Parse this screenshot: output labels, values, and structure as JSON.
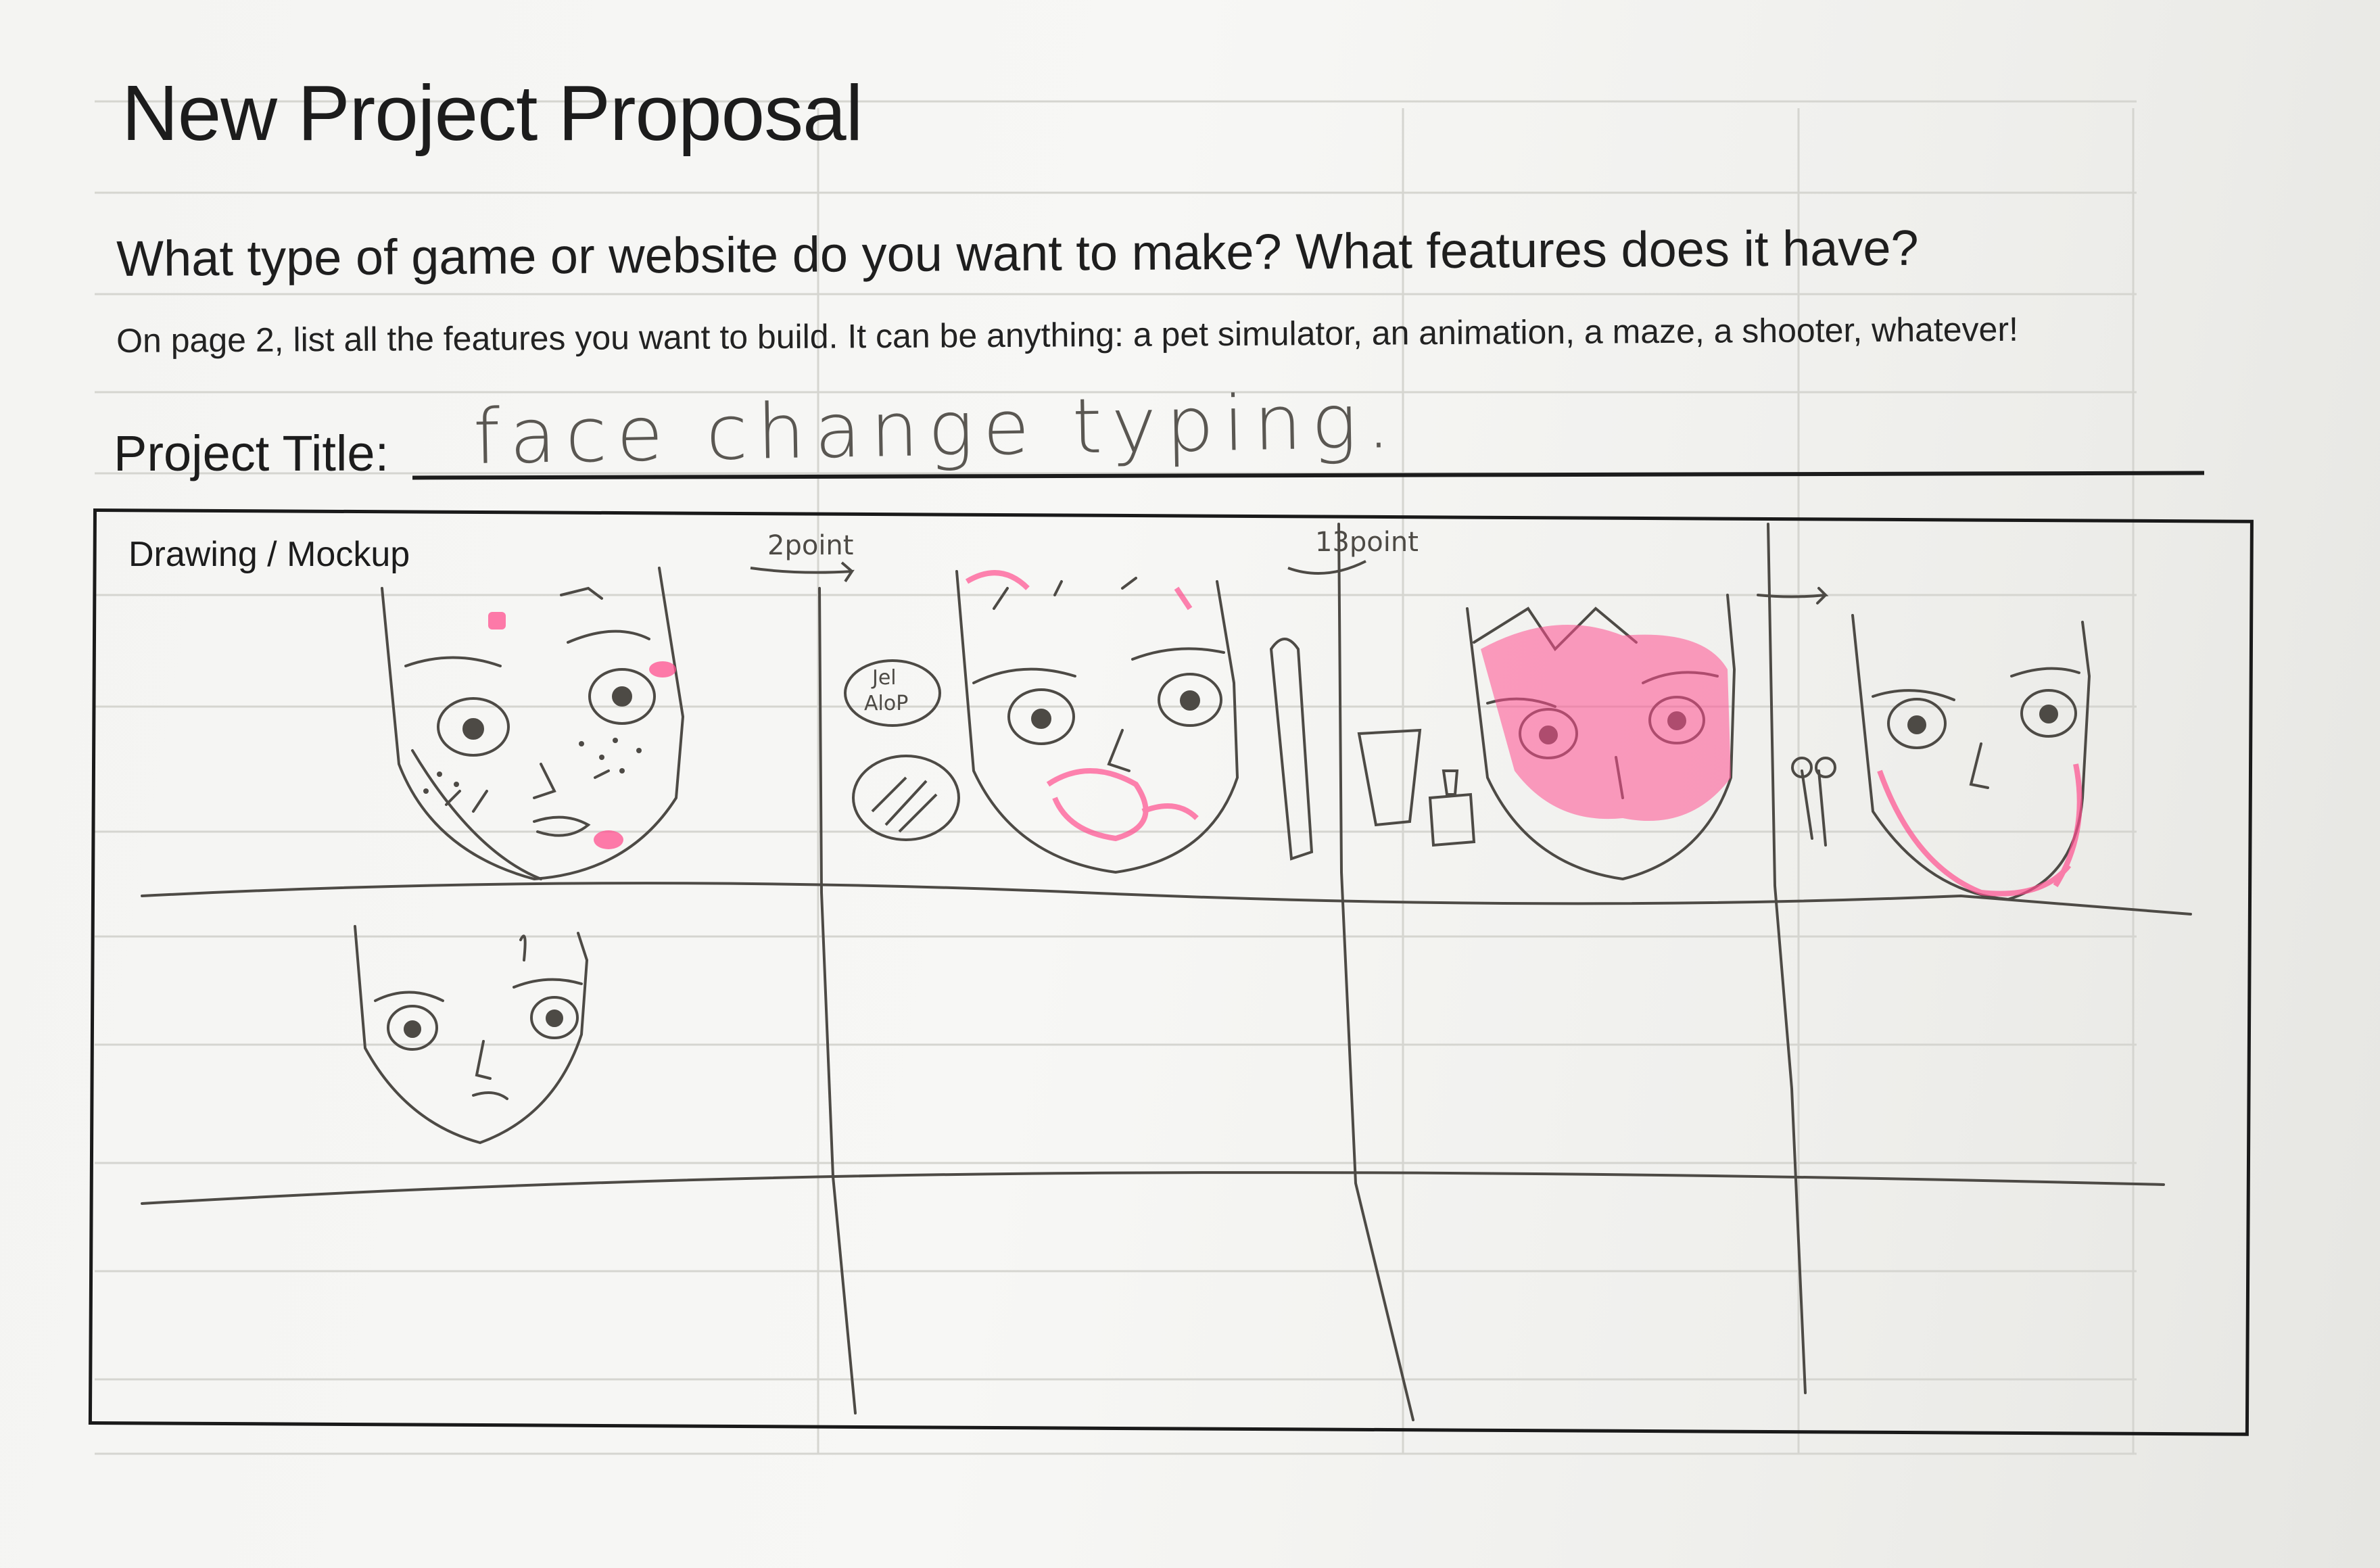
{
  "form": {
    "title": "New Project Proposal",
    "question": "What type of game or website do you want to make? What features does it have?",
    "instructions": "On page 2, list all the features you want to build. It can be anything: a pet simulator, an animation, a maze, a shooter, whatever!",
    "project_title_label": "Project Title:",
    "project_title_value": "face change typing.",
    "mockup_label": "Drawing / Mockup"
  },
  "sketch": {
    "annotation_1": "2point",
    "annotation_2": "13point",
    "jar_label_line1": "Jel",
    "jar_label_line2": "AloP",
    "colors": {
      "pencil": "#4d4a45",
      "highlighter": "#ff4f8f",
      "grid": "#d7d7d2"
    }
  }
}
